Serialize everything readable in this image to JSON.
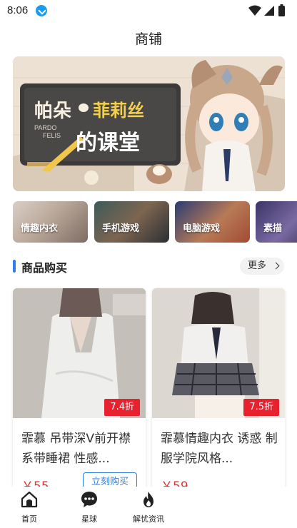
{
  "status": {
    "time": "8:06"
  },
  "header": {
    "title": "商铺"
  },
  "banner": {
    "title_line1_a": "帕朵",
    "title_line1_b": "菲莉丝",
    "title_line2": "的课堂",
    "small_text_1": "PARDO",
    "small_text_2": "FELIS"
  },
  "categories": [
    {
      "label": "情趣内衣"
    },
    {
      "label": "手机游戏"
    },
    {
      "label": "电脑游戏"
    },
    {
      "label": "素描"
    }
  ],
  "section": {
    "title": "商品购买",
    "more_label": "更多"
  },
  "products": [
    {
      "discount": "7.4折",
      "title": "霏慕 吊带深V前开襟系带睡裙 性感...",
      "price": "￥55",
      "buy_label": "立刻购买"
    },
    {
      "discount": "7.5折",
      "title": "霏慕情趣内衣 诱惑 制服学院风格...",
      "price": "￥59"
    }
  ],
  "bottom_nav": [
    {
      "label": "首页",
      "icon": "home-icon"
    },
    {
      "label": "星球",
      "icon": "chat-bubble-icon"
    },
    {
      "label": "解忧资讯",
      "icon": "flame-icon"
    }
  ],
  "colors": {
    "accent": "#2f7fe6",
    "discount": "#e7212e",
    "price": "#e7302f"
  }
}
